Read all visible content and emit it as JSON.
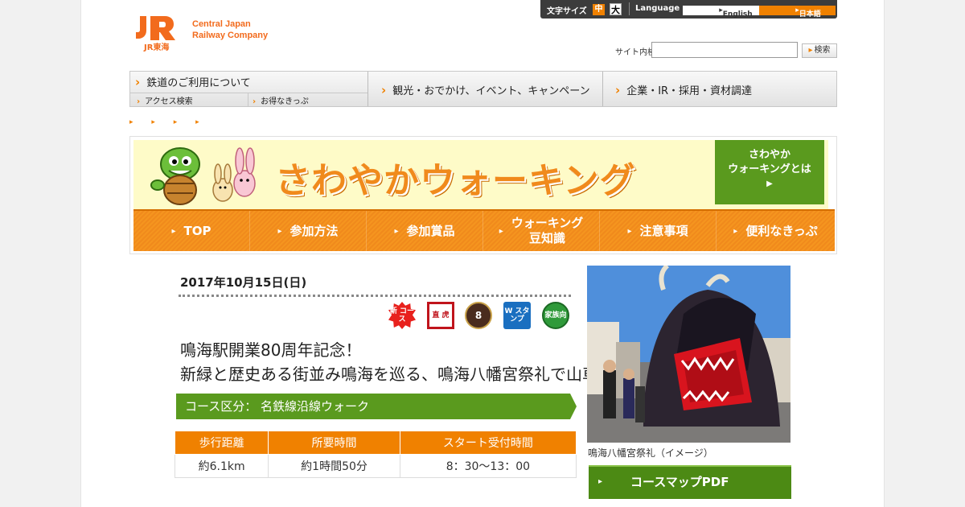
{
  "header": {
    "logo_mark": "JR東海",
    "company_line1": "Central Japan",
    "company_line2": "Railway Company",
    "font_size_label": "文字サイズ",
    "font_size_mid": "中",
    "font_size_large": "大",
    "language_label": "Language",
    "lang_english": "English",
    "lang_japanese": "日本語",
    "search_label": "サイト内検索",
    "search_value": "",
    "search_button": "検索"
  },
  "gnav": {
    "railway": "鉄道のご利用について",
    "access": "アクセス検索",
    "ticket": "お得なきっぷ",
    "tourism": "観光・おでかけ、イベント、キャンペーン",
    "corporate": "企業・IR・採用・資材調達"
  },
  "breadcrumb": "▸ ▸ ▸ ▸",
  "banner": {
    "title": "さわやかウォーキング",
    "about_line1": "さわやか",
    "about_line2": "ウォーキングとは",
    "tabs": [
      "TOP",
      "参加方法",
      "参加賞品",
      "ウォーキング\n豆知識",
      "注意事項",
      "便利なきっぷ"
    ]
  },
  "event": {
    "date": "2017年10月15日(日)",
    "badges": [
      "新 コース",
      "直 虎",
      "8",
      "W スタンプ",
      "家族向"
    ],
    "title_line1": "鳴海駅開業80周年記念！",
    "title_line2": "新緑と歴史ある街並み鳴海を巡る、鳴海八幡宮祭礼で山車を見学しよう！",
    "course_label": "コース区分： 名鉄線沿線ウォーク"
  },
  "info_table": {
    "headers": [
      "歩行距離",
      "所要時間",
      "スタート受付時間"
    ],
    "values": [
      "約6.1km",
      "約1時間50分",
      "8：30～13：00"
    ]
  },
  "photo_caption": "鳴海八幡宮祭礼（イメージ）",
  "pdf_button": "コースマップPDF"
}
